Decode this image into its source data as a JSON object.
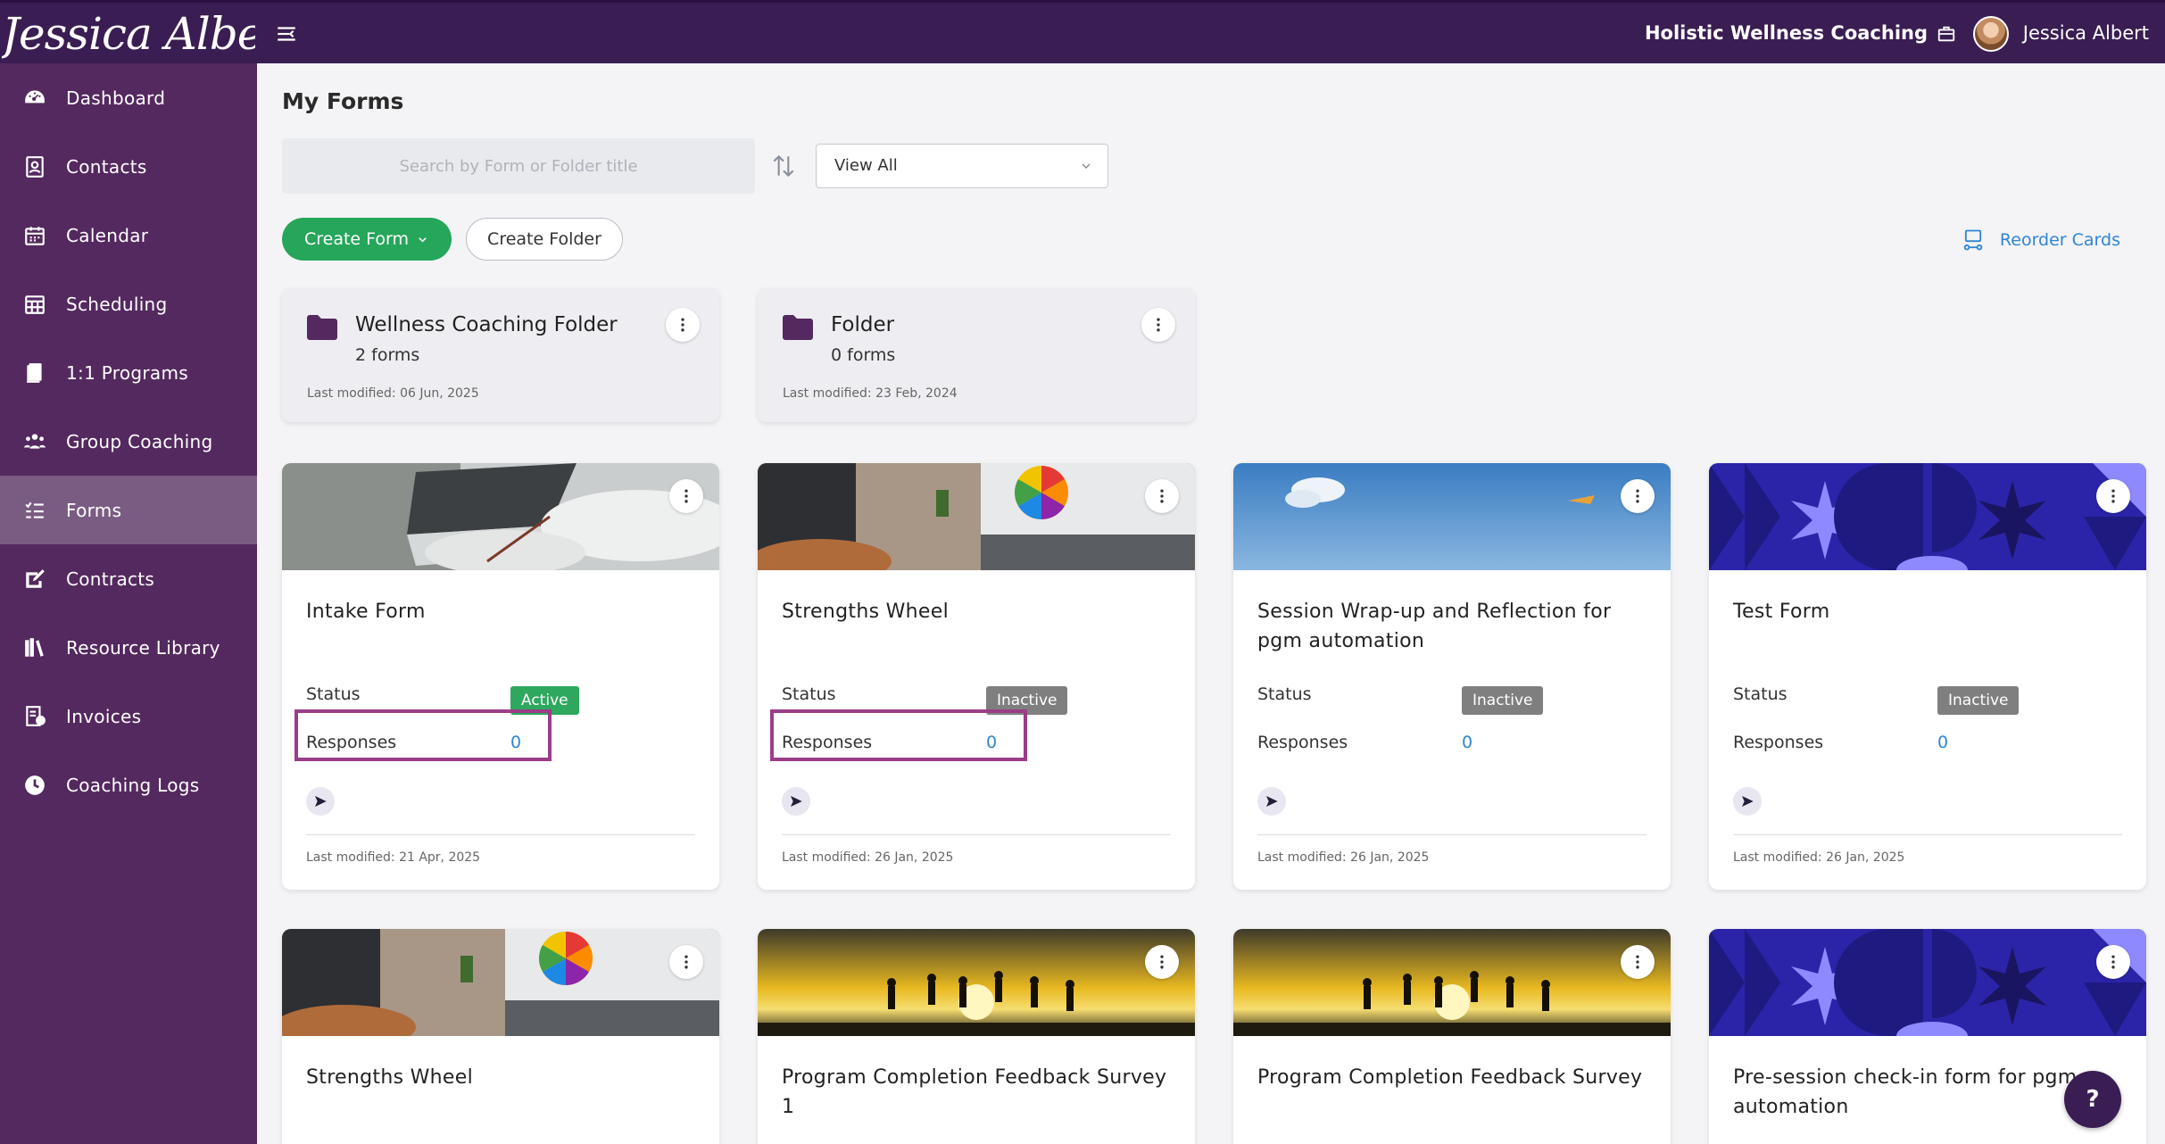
{
  "brand": {
    "logo_text": "Jessica Albert",
    "org_name": "Holistic Wellness Coaching",
    "user_name": "Jessica Albert"
  },
  "sidebar": {
    "items": [
      {
        "label": "Dashboard",
        "icon": "dashboard-icon"
      },
      {
        "label": "Contacts",
        "icon": "contacts-icon"
      },
      {
        "label": "Calendar",
        "icon": "calendar-icon"
      },
      {
        "label": "Scheduling",
        "icon": "scheduling-icon"
      },
      {
        "label": "1:1 Programs",
        "icon": "programs-icon"
      },
      {
        "label": "Group Coaching",
        "icon": "group-icon"
      },
      {
        "label": "Forms",
        "icon": "forms-icon",
        "active": true
      },
      {
        "label": "Contracts",
        "icon": "contracts-icon"
      },
      {
        "label": "Resource Library",
        "icon": "library-icon"
      },
      {
        "label": "Invoices",
        "icon": "invoices-icon"
      },
      {
        "label": "Coaching Logs",
        "icon": "clock-icon"
      }
    ]
  },
  "main": {
    "title": "My Forms",
    "search_placeholder": "Search by Form or Folder title",
    "filter_selected": "View All",
    "create_form_label": "Create Form",
    "create_folder_label": "Create Folder",
    "reorder_label": "Reorder Cards"
  },
  "folders": [
    {
      "title": "Wellness Coaching Folder",
      "count": "2 forms",
      "modified": "Last modified: 06 Jun, 2025"
    },
    {
      "title": "Folder",
      "count": "0 forms",
      "modified": "Last modified: 23 Feb, 2024"
    }
  ],
  "labels": {
    "status": "Status",
    "responses": "Responses"
  },
  "forms": [
    {
      "title": "Intake Form",
      "status": "Active",
      "responses": "0",
      "modified": "Last modified: 21 Apr, 2025"
    },
    {
      "title": "Strengths Wheel",
      "status": "Inactive",
      "responses": "0",
      "modified": "Last modified: 26 Jan, 2025"
    },
    {
      "title": "Session Wrap-up and Reflection for pgm automation",
      "status": "Inactive",
      "responses": "0",
      "modified": "Last modified: 26 Jan, 2025"
    },
    {
      "title": "Test Form",
      "status": "Inactive",
      "responses": "0",
      "modified": "Last modified: 26 Jan, 2025"
    },
    {
      "title": "Strengths Wheel"
    },
    {
      "title": "Program Completion Feedback Survey 1"
    },
    {
      "title": "Program Completion Feedback Survey"
    },
    {
      "title": "Pre-session check-in form for pgm automation"
    }
  ],
  "help_label": "?"
}
